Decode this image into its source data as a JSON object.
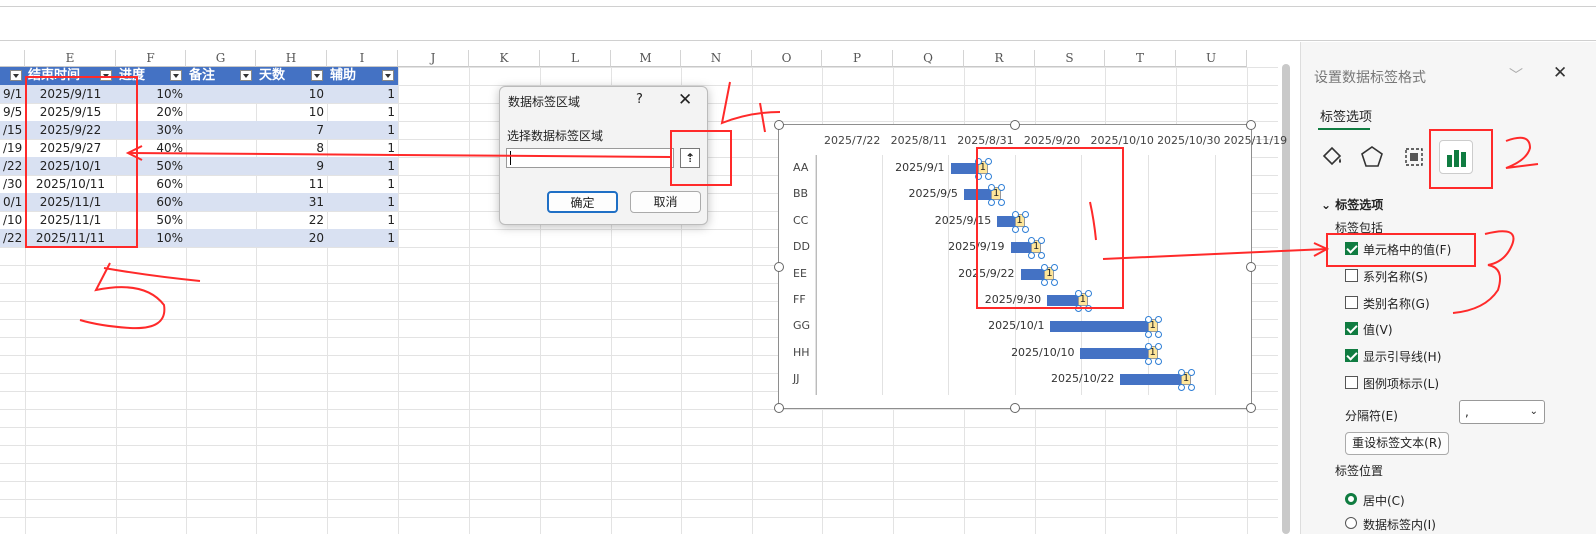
{
  "columns": [
    "E",
    "F",
    "G",
    "H",
    "I",
    "J",
    "K",
    "L",
    "M",
    "N",
    "O",
    "P",
    "Q",
    "R",
    "S",
    "T",
    "U"
  ],
  "table": {
    "headers": [
      "结束时间",
      "进度",
      "备注",
      "天数",
      "辅助"
    ],
    "d_fragments": [
      "9/1",
      "9/5",
      "/15",
      "/19",
      "/22",
      "/30",
      "0/1",
      "/10",
      "/22"
    ],
    "rows": [
      {
        "end": "2025/9/11",
        "progress": "10%",
        "note": "",
        "days": "10",
        "aux": "1"
      },
      {
        "end": "2025/9/15",
        "progress": "20%",
        "note": "",
        "days": "10",
        "aux": "1"
      },
      {
        "end": "2025/9/22",
        "progress": "30%",
        "note": "",
        "days": "7",
        "aux": "1"
      },
      {
        "end": "2025/9/27",
        "progress": "40%",
        "note": "",
        "days": "8",
        "aux": "1"
      },
      {
        "end": "2025/10/1",
        "progress": "50%",
        "note": "",
        "days": "9",
        "aux": "1"
      },
      {
        "end": "2025/10/11",
        "progress": "60%",
        "note": "",
        "days": "11",
        "aux": "1"
      },
      {
        "end": "2025/11/1",
        "progress": "60%",
        "note": "",
        "days": "31",
        "aux": "1"
      },
      {
        "end": "2025/11/1",
        "progress": "50%",
        "note": "",
        "days": "22",
        "aux": "1"
      },
      {
        "end": "2025/11/11",
        "progress": "10%",
        "note": "",
        "days": "20",
        "aux": "1"
      }
    ]
  },
  "dialog": {
    "title": "数据标签区域",
    "help": "?",
    "close": "✕",
    "label": "选择数据标签区域",
    "input_value": "",
    "upload_glyph": "⇡",
    "ok": "确定",
    "cancel": "取消"
  },
  "chart_data": {
    "type": "bar",
    "orientation": "horizontal",
    "x_tick_labels": [
      "2025/7/22",
      "2025/8/11",
      "2025/8/31",
      "2025/9/20",
      "2025/10/10",
      "2025/10/30",
      "2025/11/19"
    ],
    "categories": [
      "AA",
      "BB",
      "CC",
      "DD",
      "EE",
      "FF",
      "GG",
      "HH",
      "JJ"
    ],
    "start_labels": [
      "2025/9/1",
      "2025/9/5",
      "2025/9/15",
      "2025/9/19",
      "2025/9/22",
      "2025/9/30",
      "2025/10/1",
      "2025/10/10",
      "2025/10/22"
    ],
    "start": [
      "2025-09-01",
      "2025-09-05",
      "2025-09-15",
      "2025-09-19",
      "2025-09-22",
      "2025-09-30",
      "2025-10-01",
      "2025-10-10",
      "2025-10-22"
    ],
    "duration_days": [
      10,
      10,
      7,
      8,
      9,
      11,
      31,
      22,
      20
    ],
    "data_labels": [
      "1",
      "1",
      "1",
      "1",
      "1",
      "1",
      "1",
      "1",
      "1"
    ],
    "xlim": [
      "2025-07-22",
      "2025-11-29"
    ],
    "grid": true,
    "bar_color": "#4472c4",
    "label_color": "#ffe699"
  },
  "panel": {
    "title": "设置数据标签格式",
    "tab": "标签选项",
    "icons": [
      "fill-icon",
      "effects-icon",
      "size-properties-icon",
      "label-options-icon"
    ],
    "section": "标签选项",
    "includes": "标签包括",
    "options": [
      {
        "label": "单元格中的值(F)",
        "checked": true
      },
      {
        "label": "系列名称(S)",
        "checked": false
      },
      {
        "label": "类别名称(G)",
        "checked": false
      },
      {
        "label": "值(V)",
        "checked": true
      },
      {
        "label": "显示引导线(H)",
        "checked": true
      },
      {
        "label": "图例项标示(L)",
        "checked": false
      }
    ],
    "separator_label": "分隔符(E)",
    "separator_value": ",",
    "reset_button": "重设标签文本(R)",
    "position_label": "标签位置",
    "positions": [
      {
        "label": "居中(C)",
        "selected": true
      },
      {
        "label": "数据标签内(I)",
        "selected": false
      }
    ]
  },
  "annotations": {
    "numbers": [
      "1",
      "2",
      "3",
      "4",
      "5"
    ],
    "color": "#ff2a2a"
  }
}
